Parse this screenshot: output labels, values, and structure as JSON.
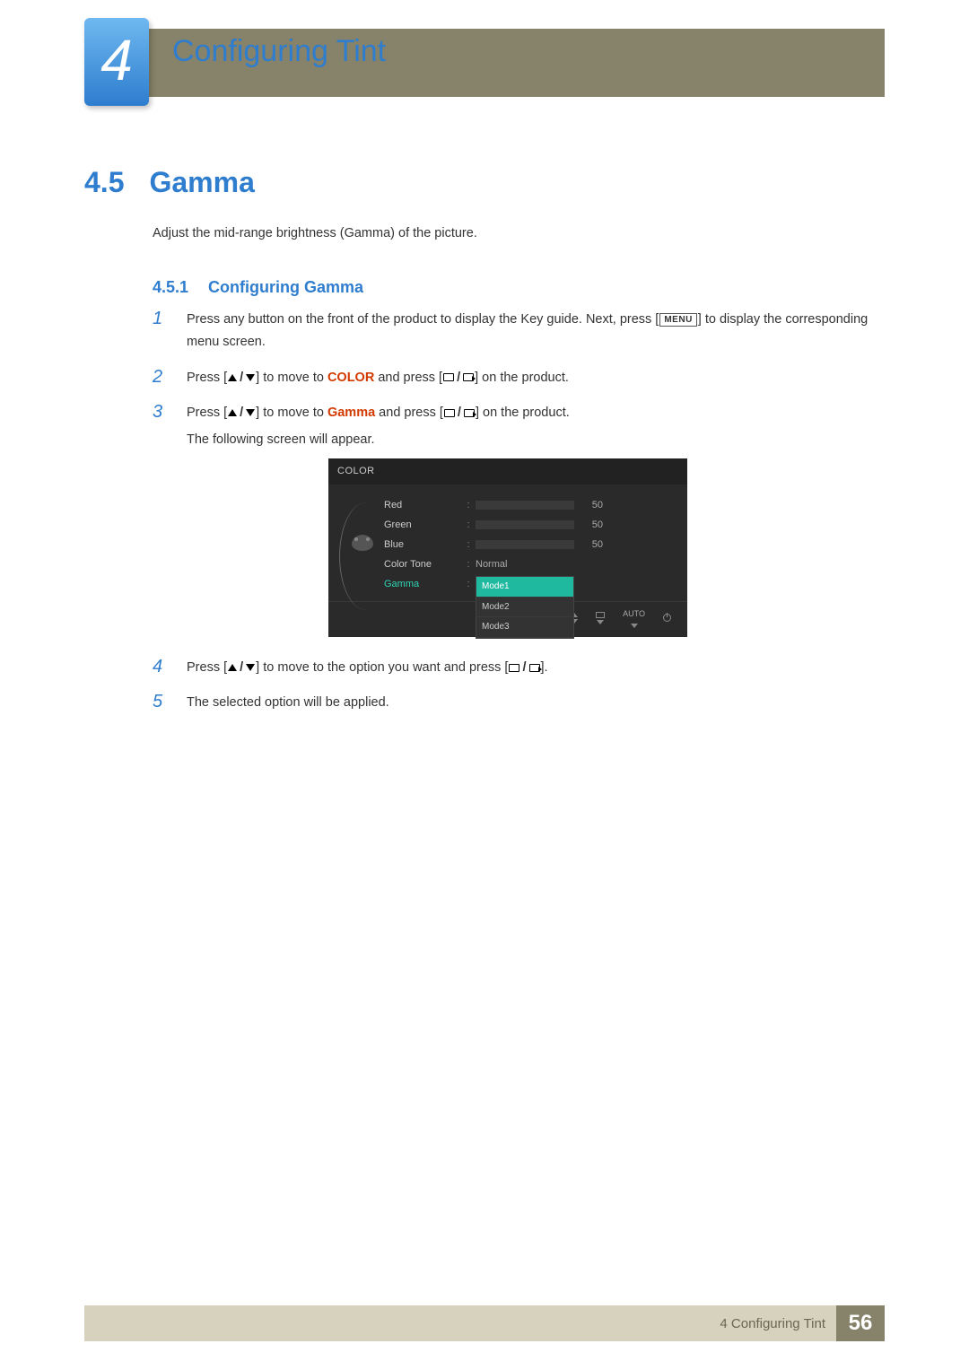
{
  "chapter": {
    "number": "4",
    "title": "Configuring Tint"
  },
  "section": {
    "number": "4.5",
    "name": "Gamma"
  },
  "intro": "Adjust the mid-range brightness (Gamma) of the picture.",
  "subsection": {
    "number": "4.5.1",
    "name": "Configuring Gamma"
  },
  "steps": {
    "n1": "1",
    "s1a": "Press any button on the front of the product to display the Key guide. Next, press [",
    "s1_menu": "MENU",
    "s1b": "] to display the corresponding menu screen.",
    "n2": "2",
    "s2a": "Press [",
    "s2b": "] to move to ",
    "s2_color": "COLOR",
    "s2c": " and press [",
    "s2d": "] on the product.",
    "n3": "3",
    "s3a": "Press [",
    "s3b": "] to move to ",
    "s3_gamma": "Gamma",
    "s3c": " and press [",
    "s3d": "] on the product.",
    "s3_follow": "The following screen will appear.",
    "n4": "4",
    "s4a": "Press [",
    "s4b": "] to move to the option you want and press [",
    "s4c": "].",
    "n5": "5",
    "s5": "The selected option will be applied."
  },
  "osd": {
    "title": "COLOR",
    "rows": {
      "red": {
        "label": "Red",
        "value": "50",
        "fill": 50
      },
      "green": {
        "label": "Green",
        "value": "50",
        "fill": 50
      },
      "blue": {
        "label": "Blue",
        "value": "50",
        "fill": 50
      },
      "tone": {
        "label": "Color Tone",
        "value": "Normal"
      },
      "gamma": {
        "label": "Gamma"
      }
    },
    "options": {
      "m1": "Mode1",
      "m2": "Mode2",
      "m3": "Mode3"
    },
    "nav_auto": "AUTO"
  },
  "footer": {
    "label": "4 Configuring Tint",
    "page": "56"
  }
}
